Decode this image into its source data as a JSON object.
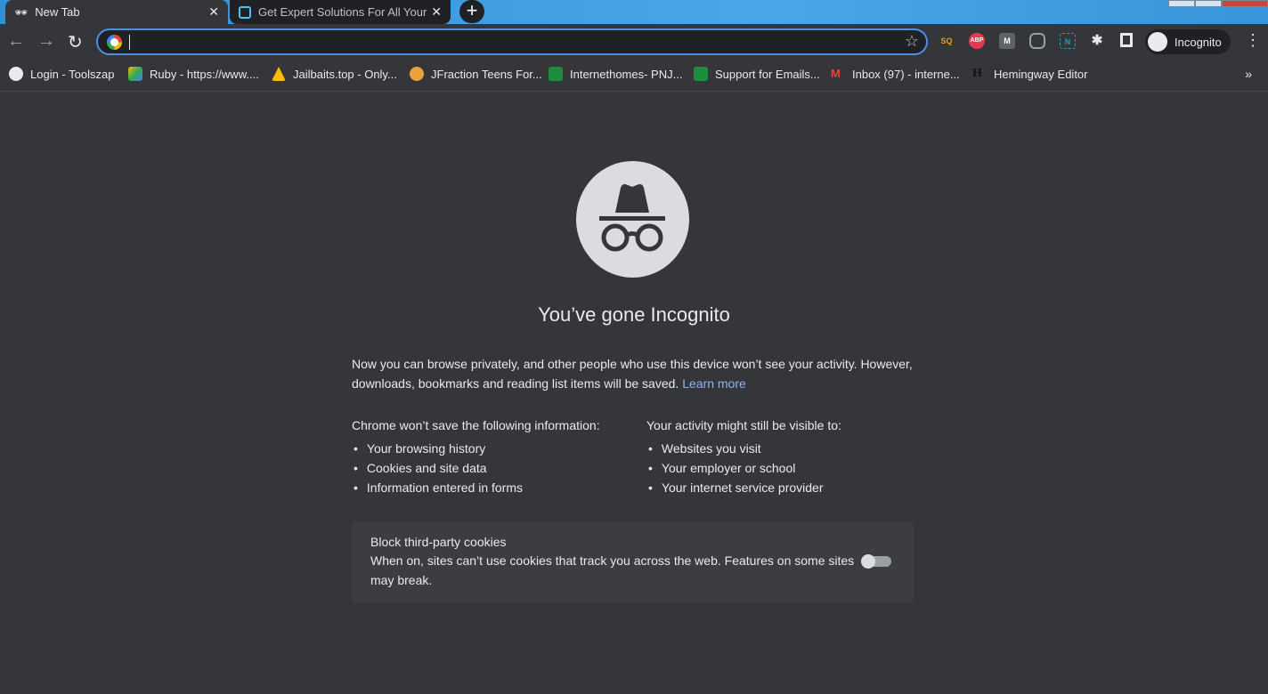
{
  "tabs": [
    {
      "title": "New Tab",
      "close": "✕",
      "icon": "incognito-icon"
    },
    {
      "title": "Get Expert Solutions For All Your",
      "close": "✕",
      "icon": "site-icon"
    }
  ],
  "new_tab": "+",
  "omnibox": {
    "value": "",
    "icon": "google-icon"
  },
  "profile": {
    "label": "Incognito"
  },
  "extensions": [
    {
      "label": "SQ",
      "color": "#f29b1d"
    },
    {
      "label": "ABP",
      "color": "#e8384f"
    },
    {
      "label": "M",
      "color": "#5f6368"
    },
    {
      "label": "",
      "color": "#9aa0a6"
    },
    {
      "label": "N",
      "color": "#17a2b8"
    }
  ],
  "bookmarks": [
    {
      "label": "Login - Toolszap",
      "color": "#e8eaed"
    },
    {
      "label": "Ruby - https://www....",
      "color": "#34a853"
    },
    {
      "label": "Jailbaits.top - Only...",
      "color": "#fbbc05"
    },
    {
      "label": "JFraction Teens For...",
      "color": "#e8a33d"
    },
    {
      "label": "Internethomes- PNJ...",
      "color": "#1e8e3e"
    },
    {
      "label": "Support for Emails...",
      "color": "#1e8e3e"
    },
    {
      "label": "Inbox (97) - interne...",
      "color": "#ea4335"
    },
    {
      "label": "Hemingway Editor",
      "color": "#202124"
    }
  ],
  "bookmarks_more": "»",
  "page": {
    "title": "You’ve gone Incognito",
    "intro": "Now you can browse privately, and other people who use this device won’t see your activity. However, downloads, bookmarks and reading list items will be saved.",
    "learn_more": "Learn more",
    "wont_save": {
      "heading": "Chrome won’t save the following information:",
      "items": [
        "Your browsing history",
        "Cookies and site data",
        "Information entered in forms"
      ]
    },
    "visible_to": {
      "heading": "Your activity might still be visible to:",
      "items": [
        "Websites you visit",
        "Your employer or school",
        "Your internet service provider"
      ]
    },
    "cookies": {
      "title": "Block third-party cookies",
      "description": "When on, sites can’t use cookies that track you across the web. Features on some sites may break.",
      "enabled": false
    }
  }
}
